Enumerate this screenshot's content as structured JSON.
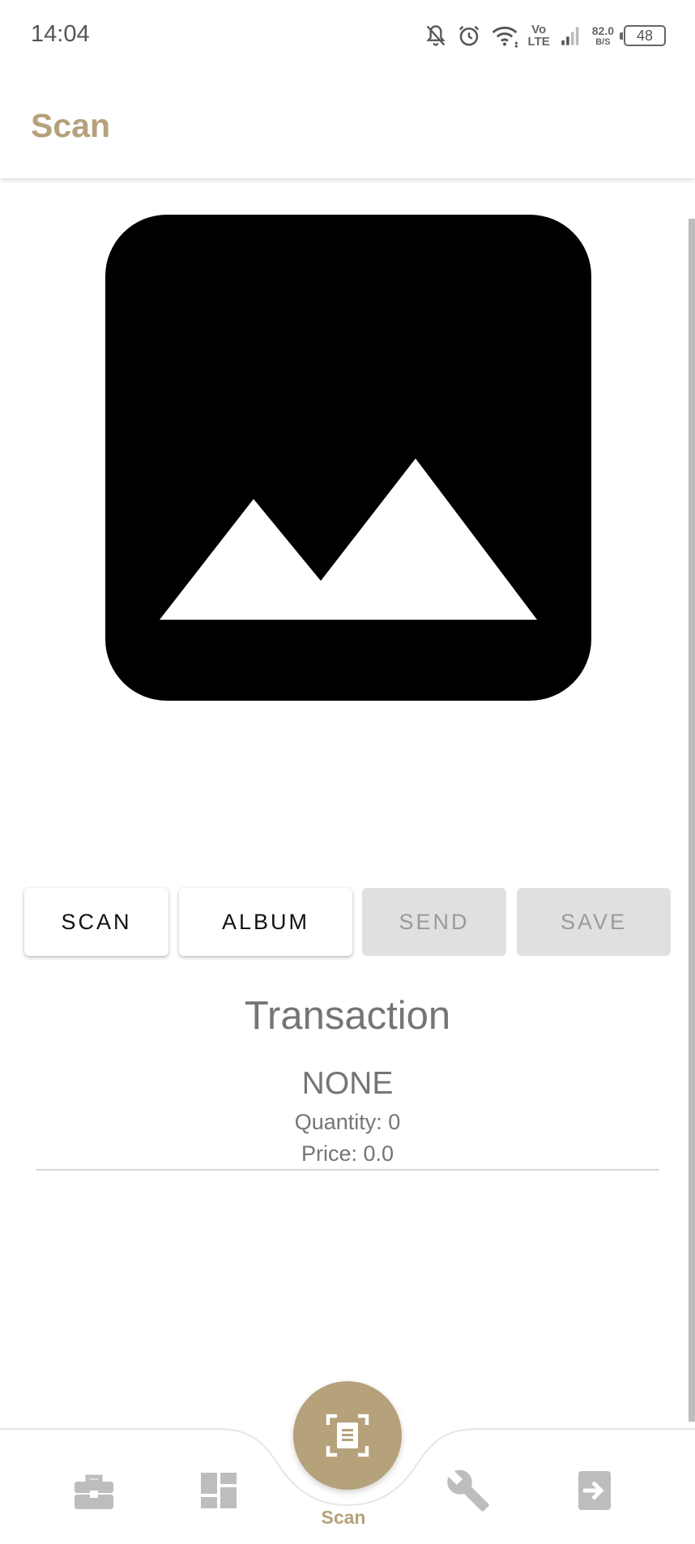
{
  "status_bar": {
    "time": "14:04",
    "network_speed_value": "82.0",
    "network_speed_unit": "B/S",
    "volte_top": "Vo",
    "volte_bottom": "LTE",
    "battery": "48"
  },
  "app_bar": {
    "title": "Scan"
  },
  "image": {
    "icon": "image-placeholder-icon"
  },
  "actions": {
    "scan_label": "SCAN",
    "album_label": "ALBUM",
    "send_label": "SEND",
    "save_label": "SAVE"
  },
  "transaction": {
    "title": "Transaction",
    "type": "NONE",
    "quantity": "Quantity: 0",
    "price": "Price: 0.0"
  },
  "bottom_nav": {
    "items": [
      {
        "icon": "briefcase-icon"
      },
      {
        "icon": "dashboard-icon"
      },
      {
        "icon": "scan-document-icon",
        "label": "Scan"
      },
      {
        "icon": "wrench-icon"
      },
      {
        "icon": "login-icon"
      }
    ]
  },
  "colors": {
    "accent": "#b5a17a",
    "text_gray": "#757575",
    "disabled_bg": "#e0e0e0",
    "inactive_icon": "#bdbdbd"
  }
}
